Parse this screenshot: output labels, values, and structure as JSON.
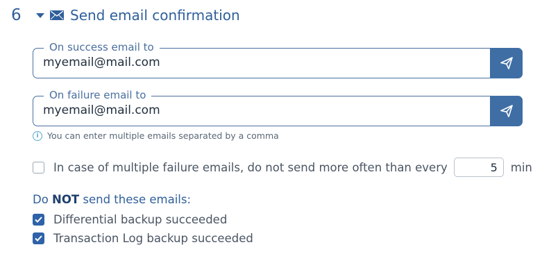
{
  "section": {
    "number": "6",
    "title": "Send email confirmation",
    "icons": [
      "caret-down-icon",
      "envelope-icon"
    ]
  },
  "success_email": {
    "legend": "On success email to",
    "value": "myemail@mail.com",
    "button_icon": "send-icon"
  },
  "failure_email": {
    "legend": "On failure email to",
    "value": "myemail@mail.com",
    "button_icon": "send-icon"
  },
  "hint": "You can enter multiple emails separated by a comma",
  "frequency": {
    "checked": false,
    "label": "In case of multiple failure emails, do not send more often than every",
    "value": "5",
    "unit": "min"
  },
  "do_not_send": {
    "prefix": "Do ",
    "emphasis": "NOT",
    "suffix": " send these emails:",
    "options": [
      {
        "label": "Differential backup succeeded",
        "checked": true
      },
      {
        "label": "Transaction Log backup succeeded",
        "checked": true
      }
    ]
  },
  "colors": {
    "accent": "#2f5f9a",
    "button": "#3f6ea5",
    "checkbox_checked": "#2f62a8"
  }
}
